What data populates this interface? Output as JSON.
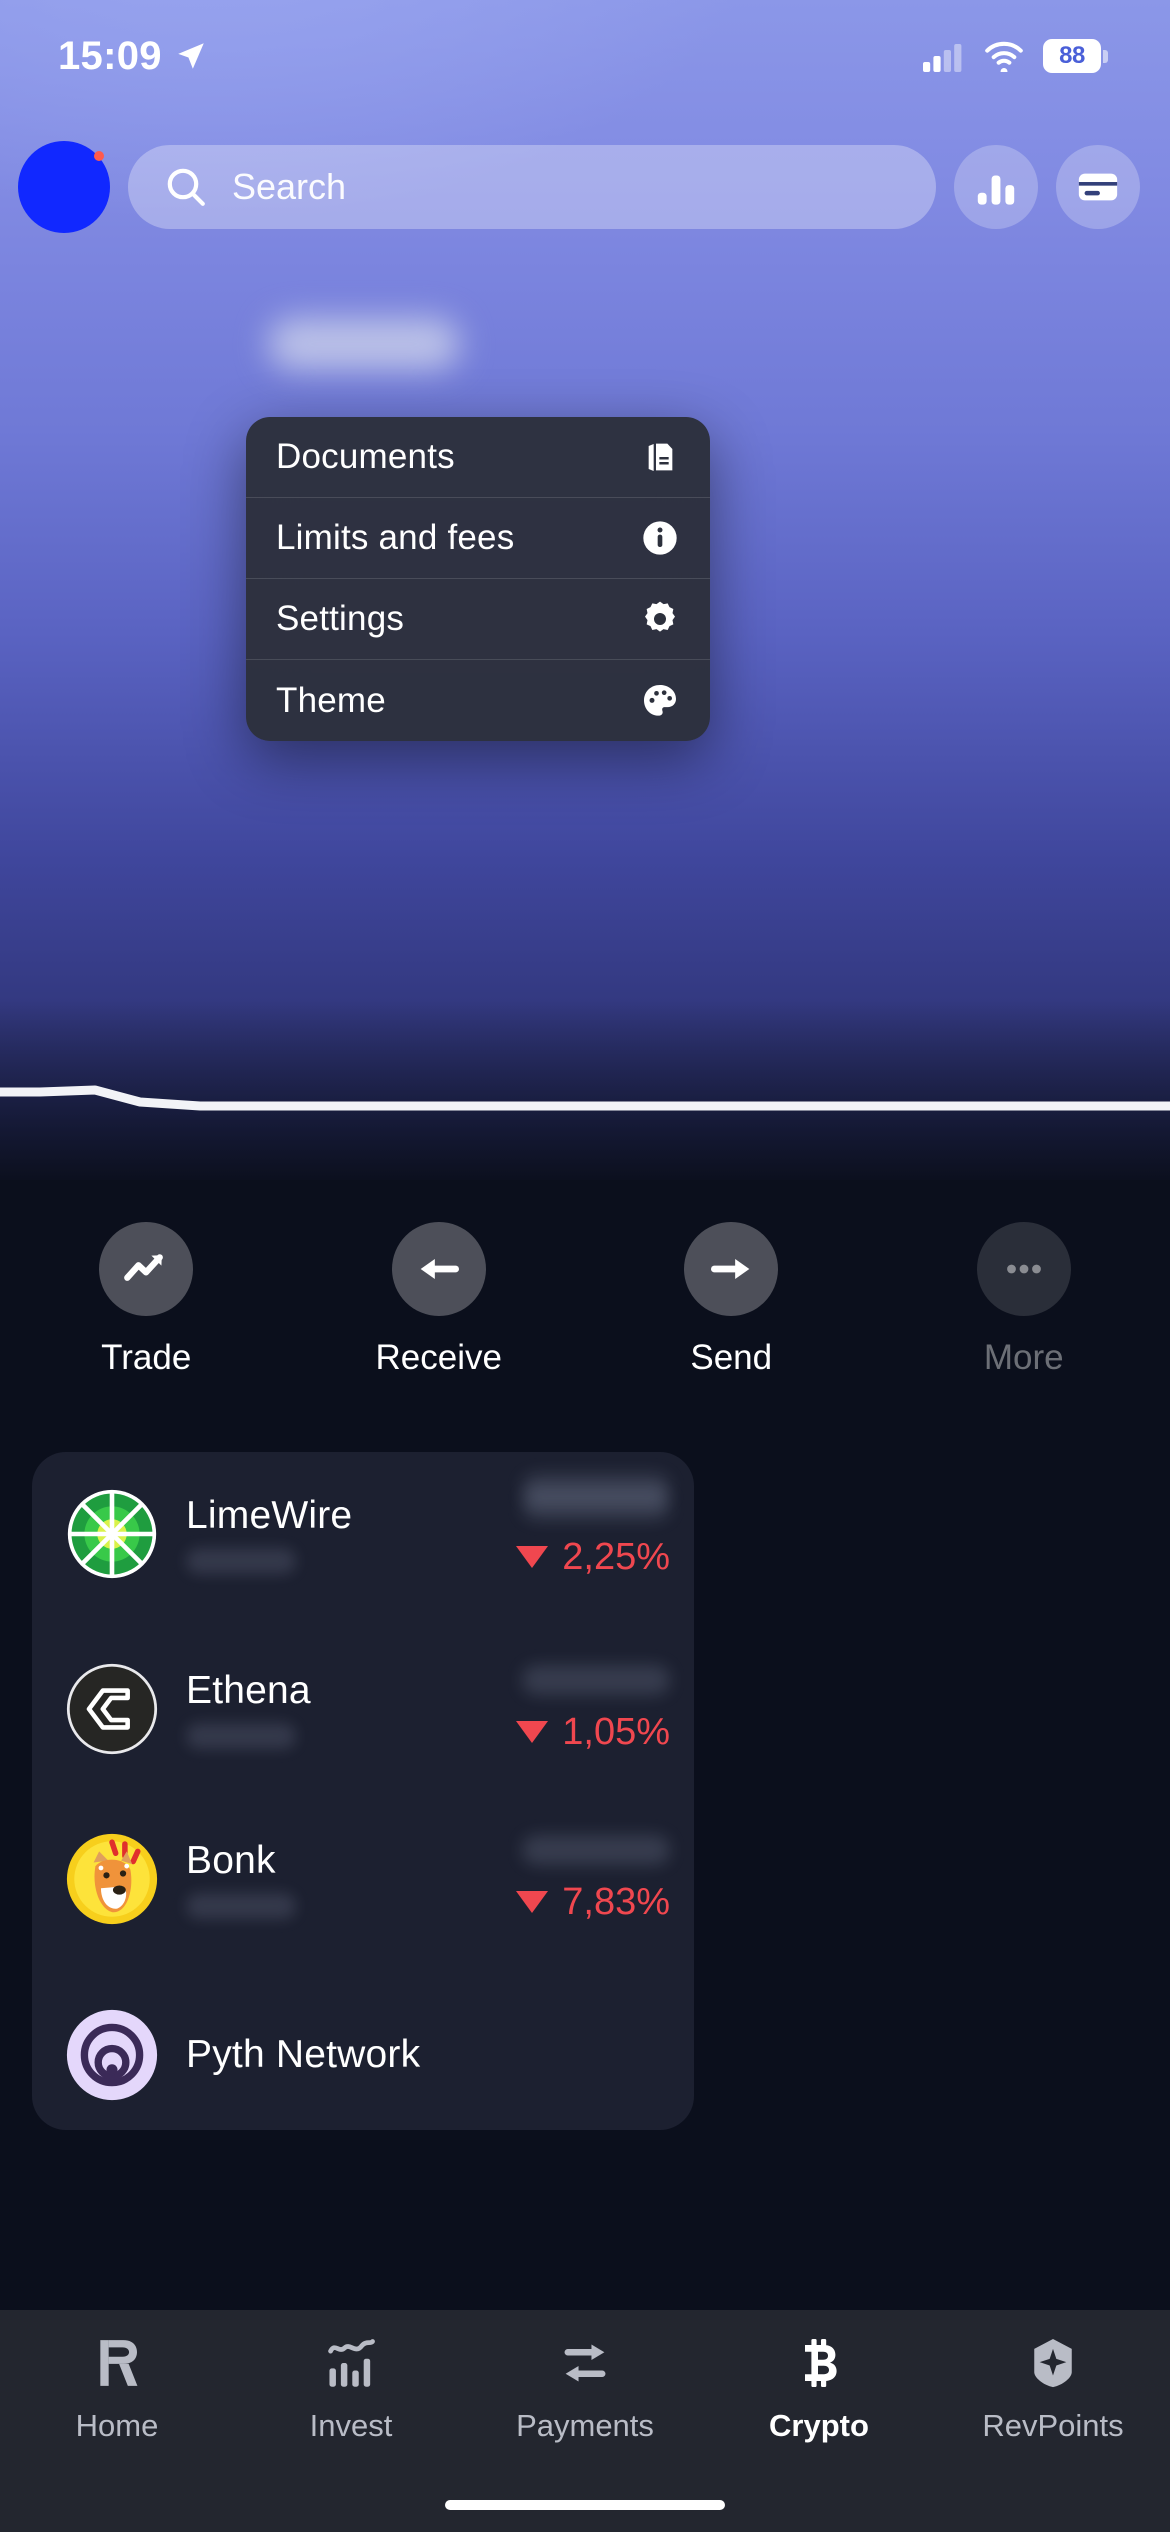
{
  "status_bar": {
    "time": "15:09",
    "location_icon": "location-arrow-icon",
    "cellular_icon": "cellular-bars-icon",
    "wifi_icon": "wifi-icon",
    "battery_level": "88"
  },
  "header": {
    "avatar": "user-avatar",
    "search": {
      "placeholder": "Search",
      "icon": "search-icon"
    },
    "analytics_button_icon": "bar-chart-icon",
    "cards_button_icon": "credit-card-icon"
  },
  "context_menu": {
    "items": [
      {
        "label": "Documents",
        "icon": "documents-icon"
      },
      {
        "label": "Limits and fees",
        "icon": "info-circle-icon"
      },
      {
        "label": "Settings",
        "icon": "gear-icon"
      },
      {
        "label": "Theme",
        "icon": "palette-icon"
      }
    ]
  },
  "actions": [
    {
      "label": "Trade",
      "icon": "trending-up-icon",
      "dimmed": false
    },
    {
      "label": "Receive",
      "icon": "arrow-left-icon",
      "dimmed": false
    },
    {
      "label": "Send",
      "icon": "arrow-right-icon",
      "dimmed": false
    },
    {
      "label": "More",
      "icon": "ellipsis-icon",
      "dimmed": true
    }
  ],
  "assets": [
    {
      "name": "LimeWire",
      "change": "2,25%",
      "direction": "down",
      "logo": "limewire-logo"
    },
    {
      "name": "Ethena",
      "change": "1,05%",
      "direction": "down",
      "logo": "ethena-logo"
    },
    {
      "name": "Bonk",
      "change": "7,83%",
      "direction": "down",
      "logo": "bonk-logo"
    },
    {
      "name": "Pyth Network",
      "change": "",
      "direction": "",
      "logo": "pyth-logo"
    }
  ],
  "bottom_nav": {
    "items": [
      {
        "label": "Home",
        "icon": "revolut-r-icon",
        "active": false
      },
      {
        "label": "Invest",
        "icon": "invest-chart-icon",
        "active": false
      },
      {
        "label": "Payments",
        "icon": "swap-arrows-icon",
        "active": false
      },
      {
        "label": "Crypto",
        "icon": "bitcoin-icon",
        "active": true
      },
      {
        "label": "RevPoints",
        "icon": "revpoints-hex-icon",
        "active": false
      }
    ]
  },
  "colors": {
    "negative": "#f0474f",
    "card_bg": "#1c2030",
    "nav_bg": "#23262f",
    "avatar": "#1128ff"
  }
}
